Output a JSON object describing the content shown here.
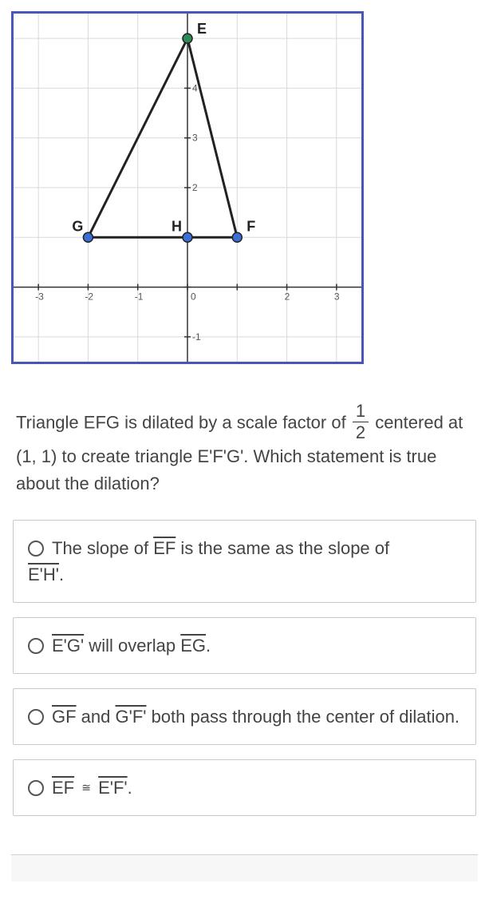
{
  "graph": {
    "labels": {
      "E": "E",
      "G": "G",
      "H": "H",
      "F": "F"
    },
    "ticks": {
      "xneg3": "-3",
      "xneg2": "-2",
      "xneg1": "-1",
      "x0": "0",
      "x2": "2",
      "x3": "3",
      "yneg1": "-1",
      "y2": "2",
      "y3": "3",
      "y4": "4"
    },
    "points": {
      "E": {
        "x": 0,
        "y": 5
      },
      "G": {
        "x": -2,
        "y": 1
      },
      "H": {
        "x": 0,
        "y": 1
      },
      "F": {
        "x": 1,
        "y": 1
      }
    },
    "axes": {
      "xmin": -3.5,
      "xmax": 3.5,
      "ymin": -1.5,
      "ymax": 5.5
    }
  },
  "question": {
    "part1": "Triangle EFG is dilated by a scale factor of ",
    "frac_num": "1",
    "frac_den": "2",
    "part2": " centered at (1, 1) to create triangle E'F'G'. Which statement is true about the dilation?"
  },
  "choices": {
    "a": {
      "pre": "The slope of ",
      "seg1": "EF",
      "mid": " is the same as the slope of ",
      "seg2": "E'H'",
      "post": "."
    },
    "b": {
      "seg1": "E'G'",
      "mid": " will overlap ",
      "seg2": "EG",
      "post": "."
    },
    "c": {
      "seg1": "GF",
      "mid": " and ",
      "seg2": "G'F'",
      "post": " both pass through the center of dilation."
    },
    "d": {
      "seg1": "EF",
      "seg2": "E'F'",
      "post": "."
    }
  }
}
